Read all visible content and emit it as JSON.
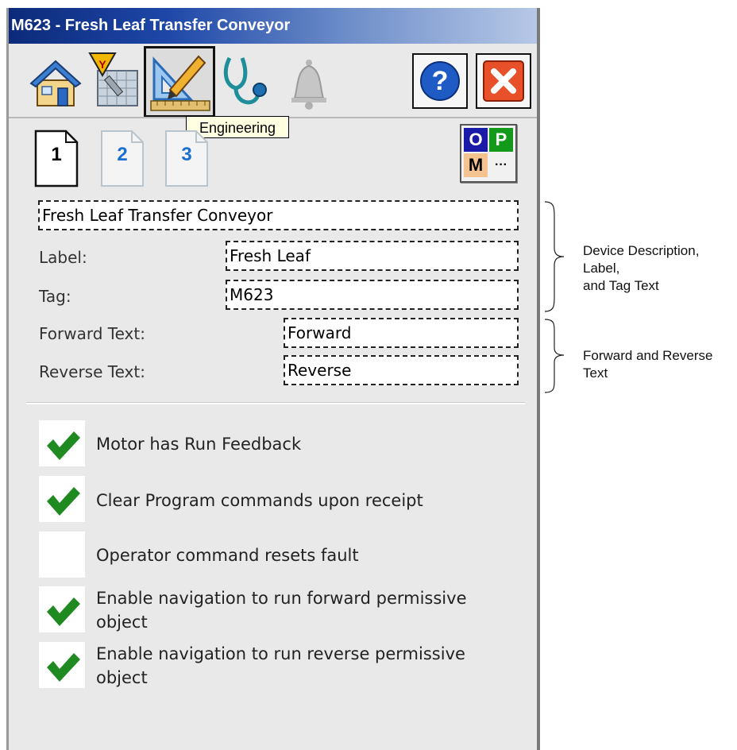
{
  "window": {
    "title": "M623 - Fresh Leaf Transfer Conveyor"
  },
  "toolbar": {
    "icons": [
      "home-icon",
      "maintenance-icon",
      "engineering-icon",
      "diagnostics-icon",
      "alarm-bell-icon",
      "help-icon",
      "close-icon"
    ],
    "help_label": "?",
    "tooltip": "Engineering"
  },
  "pages": {
    "tabs": [
      "1",
      "2",
      "3"
    ],
    "active": "1"
  },
  "opm": {
    "o": "O",
    "p": "P",
    "m": "M",
    "more": "···"
  },
  "fields": {
    "description": "Fresh Leaf Transfer Conveyor",
    "label_caption": "Label:",
    "label_value": "Fresh Leaf",
    "tag_caption": "Tag:",
    "tag_value": "M623",
    "forward_caption": "Forward Text:",
    "forward_value": "Forward",
    "reverse_caption": "Reverse Text:",
    "reverse_value": "Reverse"
  },
  "options": [
    {
      "text": "Motor has Run Feedback",
      "checked": true
    },
    {
      "text": "Clear Program commands upon receipt",
      "checked": true
    },
    {
      "text": "Operator command resets fault",
      "checked": false
    },
    {
      "text": "Enable navigation to run forward permissive object",
      "checked": true
    },
    {
      "text": "Enable navigation to run reverse permissive object",
      "checked": true
    }
  ],
  "annotations": {
    "device_text_line1": "Device Description, Label,",
    "device_text_line2": "and Tag Text",
    "fwd_rev": "Forward and Reverse Text"
  },
  "colors": {
    "check": "#1f8a1f",
    "tab_number": "#1a6fd0",
    "opm_o": "#1a1aa8",
    "opm_p": "#139a1a",
    "opm_m": "#f4c38f"
  }
}
